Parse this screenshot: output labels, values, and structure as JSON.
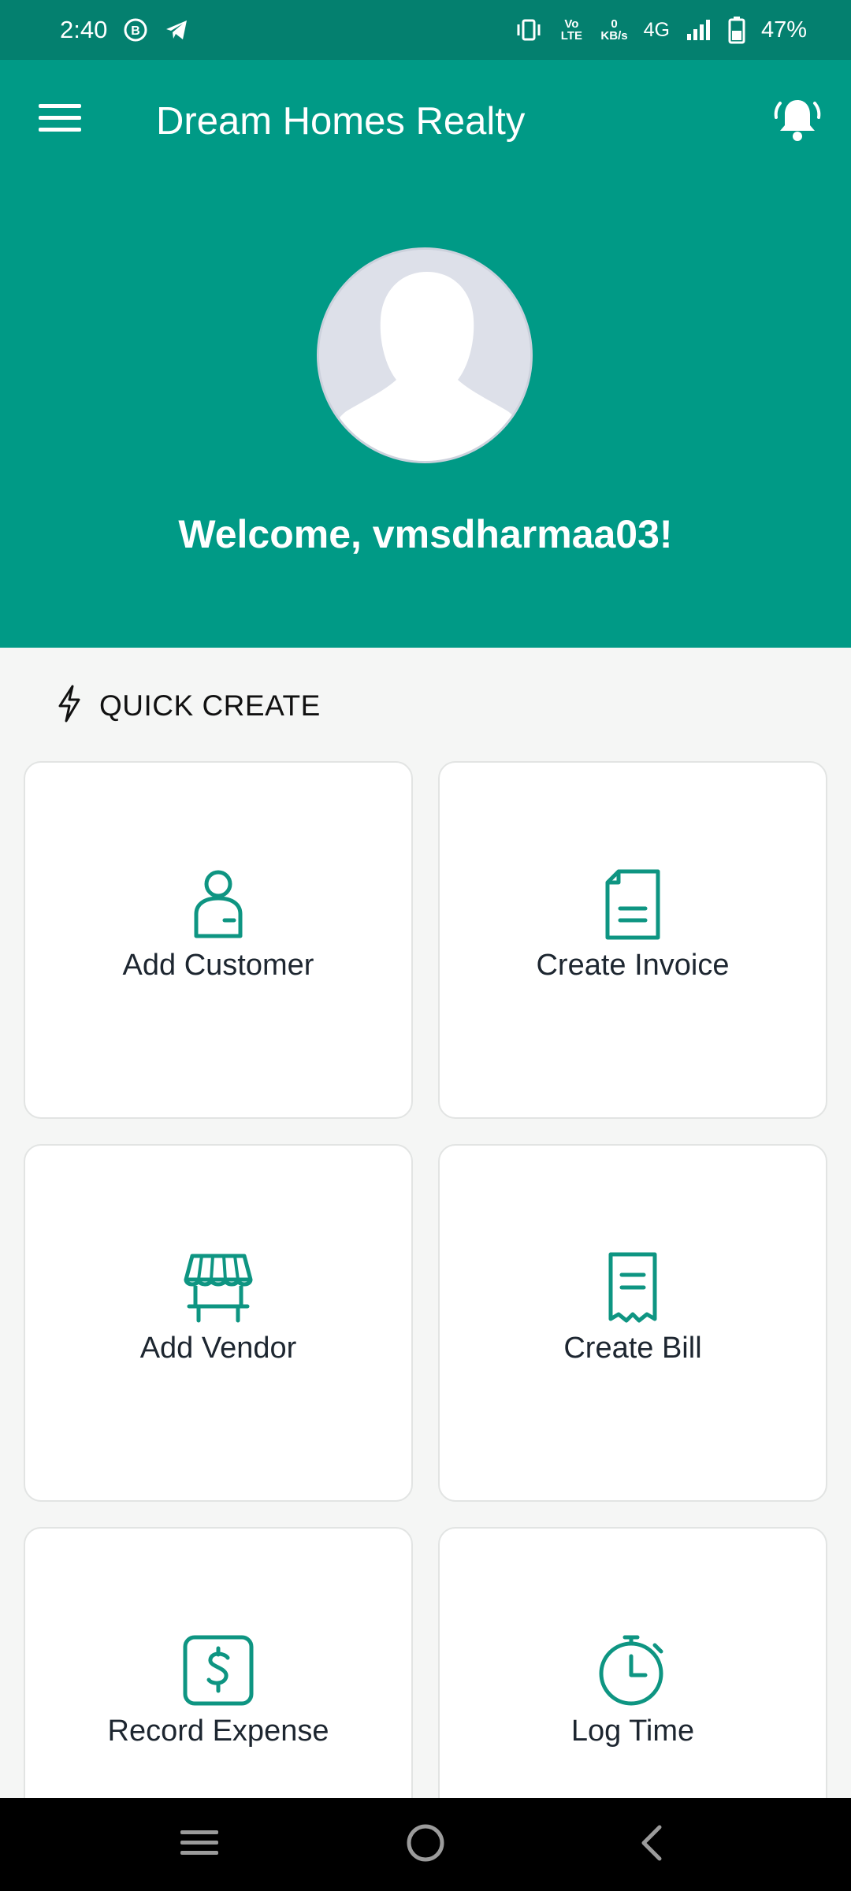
{
  "status_bar": {
    "time": "2:40",
    "lte_label": "Vo LTE",
    "speed_value": "0",
    "speed_unit": "KB/s",
    "network": "4G",
    "battery": "47%"
  },
  "app_bar": {
    "title": "Dream Homes Realty",
    "menu_icon": "hamburger-menu-icon",
    "notification_icon": "bell-icon"
  },
  "profile": {
    "welcome": "Welcome, vmsdharmaa03!"
  },
  "quick_create": {
    "title": "QUICK CREATE",
    "items": [
      {
        "label": "Add Customer",
        "icon": "person-icon"
      },
      {
        "label": "Create Invoice",
        "icon": "document-icon"
      },
      {
        "label": "Add Vendor",
        "icon": "storefront-icon"
      },
      {
        "label": "Create Bill",
        "icon": "receipt-icon"
      },
      {
        "label": "Record Expense",
        "icon": "dollar-icon"
      },
      {
        "label": "Log Time",
        "icon": "stopwatch-icon"
      }
    ]
  },
  "colors": {
    "primary": "#009a86",
    "status_bar": "#04806f",
    "icon_accent": "#0e9582",
    "background": "#f5f6f5"
  }
}
